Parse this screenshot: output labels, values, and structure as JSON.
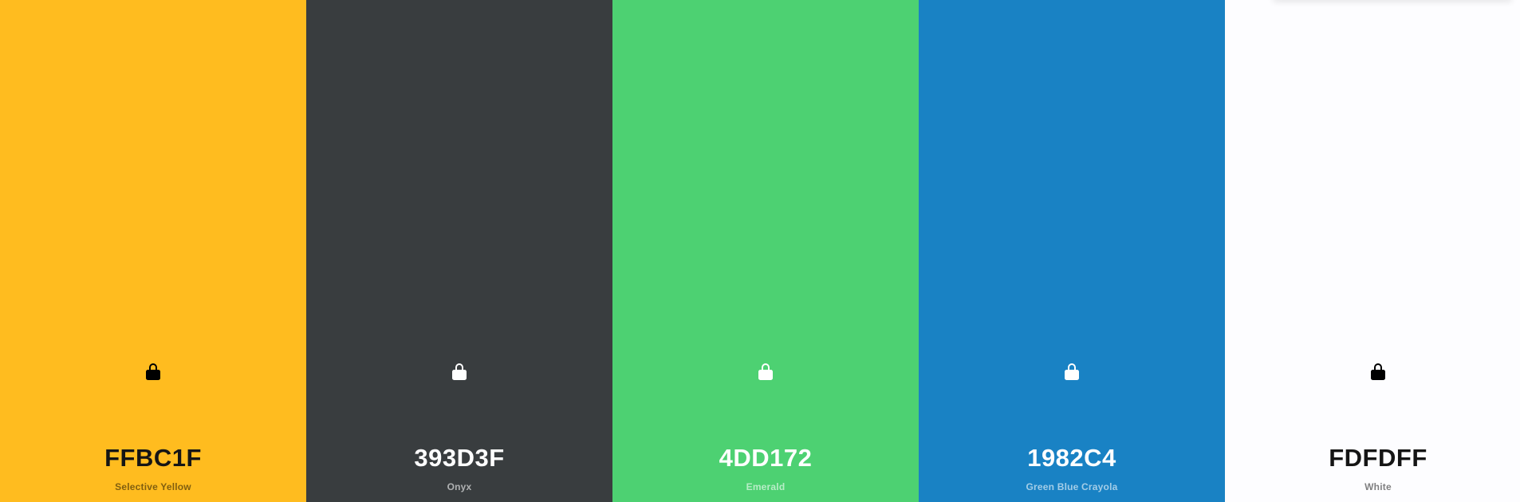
{
  "palette": {
    "colors": [
      {
        "hex": "FFBC1F",
        "name": "Selective Yellow",
        "bg": "#FFBC1F",
        "text_theme": "dark"
      },
      {
        "hex": "393D3F",
        "name": "Onyx",
        "bg": "#393D3F",
        "text_theme": "light"
      },
      {
        "hex": "4DD172",
        "name": "Emerald",
        "bg": "#4DD172",
        "text_theme": "light"
      },
      {
        "hex": "1982C4",
        "name": "Green Blue Crayola",
        "bg": "#1982C4",
        "text_theme": "light"
      },
      {
        "hex": "FDFDFF",
        "name": "White",
        "bg": "#FDFDFF",
        "text_theme": "dark"
      }
    ],
    "lock_icon": "lock-icon"
  }
}
